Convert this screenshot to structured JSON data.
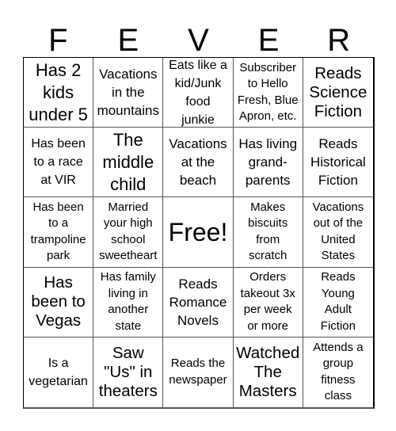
{
  "header": {
    "letters": [
      "F",
      "E",
      "V",
      "E",
      "R"
    ]
  },
  "cells": [
    [
      "Has 2 kids under 5",
      "Vacations in the mountains",
      "Eats like a kid/Junk food junkie",
      "Subscriber to Hello Fresh, Blue Apron, etc.",
      "Reads Science Fiction"
    ],
    [
      "Has been to a race at VIR",
      "The middle child",
      "Vacations at the beach",
      "Has living grand-parents",
      "Reads Historical Fiction"
    ],
    [
      "Has been to a trampoline park",
      "Married your high school sweetheart",
      "Free!",
      "Makes biscuits from scratch",
      "Vacations out of the United States"
    ],
    [
      "Has been to Vegas",
      "Has family living in another state",
      "Reads Romance Novels",
      "Orders takeout 3x per week or more",
      "Reads Young Adult Fiction"
    ],
    [
      "Is a vegetarian",
      "Saw \"Us\" in theaters",
      "Reads the newspaper",
      "Watched The Masters",
      "Attends a group fitness class"
    ]
  ],
  "cell_lines": [
    [
      [
        "Has 2",
        "kids",
        "under 5"
      ],
      [
        "Vacations",
        "in the",
        "mountains"
      ],
      [
        "Eats like a",
        "kid/Junk",
        "food",
        "junkie"
      ],
      [
        "Subscriber",
        "to Hello",
        "Fresh, Blue",
        "Apron, etc."
      ],
      [
        "Reads",
        "Science",
        "Fiction"
      ]
    ],
    [
      [
        "Has been",
        "to a race",
        "at VIR"
      ],
      [
        "The",
        "middle",
        "child"
      ],
      [
        "Vacations",
        "at the",
        "beach"
      ],
      [
        "Has living",
        "grand-",
        "parents"
      ],
      [
        "Reads",
        "Historical",
        "Fiction"
      ]
    ],
    [
      [
        "Has been",
        "to a",
        "trampoline",
        "park"
      ],
      [
        "Married",
        "your high",
        "school",
        "sweetheart"
      ],
      [
        "Free!"
      ],
      [
        "Makes",
        "biscuits",
        "from",
        "scratch"
      ],
      [
        "Vacations",
        "out of the",
        "United",
        "States"
      ]
    ],
    [
      [
        "Has",
        "been to",
        "Vegas"
      ],
      [
        "Has family",
        "living in",
        "another",
        "state"
      ],
      [
        "Reads",
        "Romance",
        "Novels"
      ],
      [
        "Orders",
        "takeout 3x",
        "per week",
        "or more"
      ],
      [
        "Reads",
        "Young",
        "Adult",
        "Fiction"
      ]
    ],
    [
      [
        "Is a",
        "vegetarian"
      ],
      [
        "Saw",
        "\"Us\" in",
        "theaters"
      ],
      [
        "Reads the",
        "newspaper"
      ],
      [
        "Watched",
        "The",
        "Masters"
      ],
      [
        "Attends a",
        "group",
        "fitness",
        "class"
      ]
    ]
  ]
}
